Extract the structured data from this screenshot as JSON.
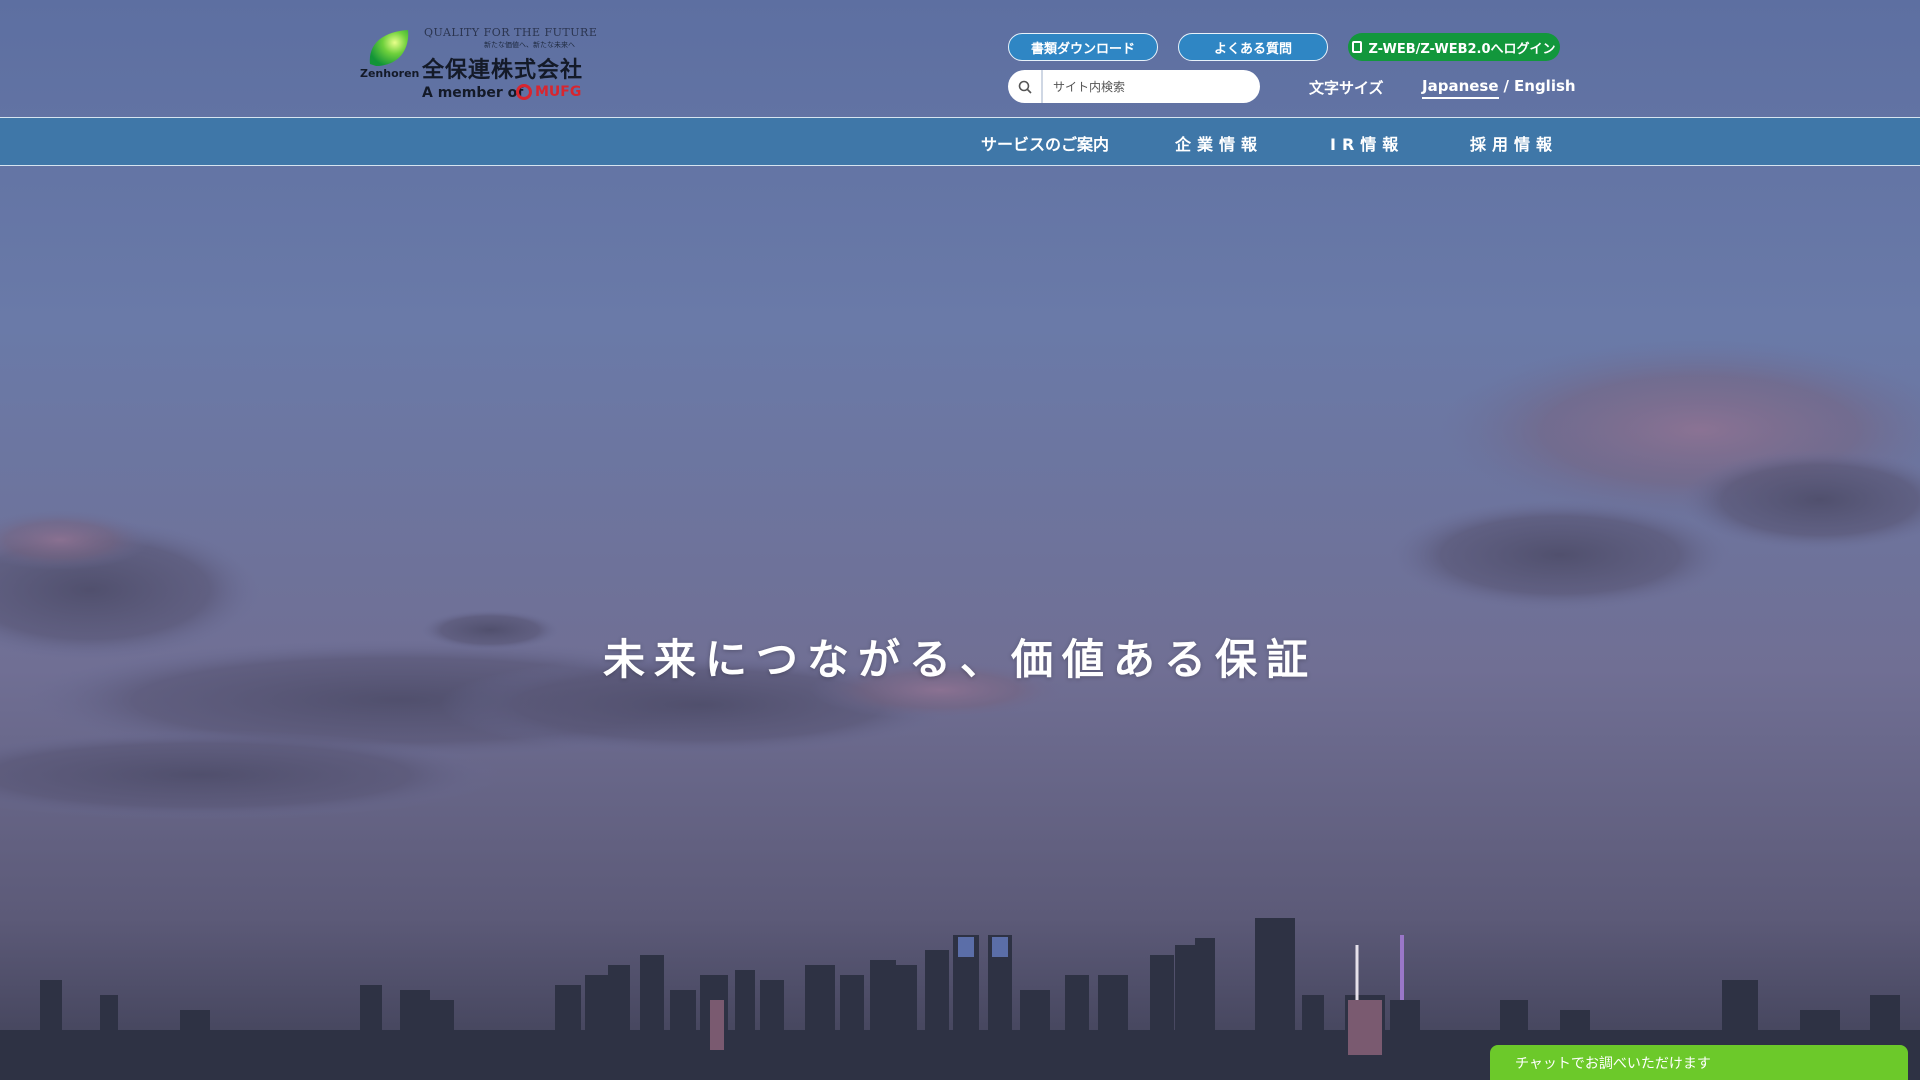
{
  "brand": {
    "tagline": "QUALITY FOR THE FUTURE",
    "subtagline": "新たな価値へ、新たな未来へ",
    "company_name": "全保連株式会社",
    "romaji": "Zenhoren",
    "member_prefix": "A member of",
    "group_name": "MUFG",
    "accent_color": "#2f86c4",
    "login_color": "#12973c"
  },
  "utility": {
    "download_label": "書類ダウンロード",
    "faq_label": "よくある質問",
    "login_label": "Z-WEB/Z-WEB2.0へログイン",
    "search_placeholder": "サイト内検索",
    "font_size_label": "文字サイズ",
    "lang_japanese": "Japanese",
    "lang_separator": "/",
    "lang_english": "English"
  },
  "nav": {
    "items": [
      {
        "label": "サービスのご案内"
      },
      {
        "label": "企業情報"
      },
      {
        "label": "IR情報"
      },
      {
        "label": "採用情報"
      }
    ]
  },
  "hero": {
    "headline": "未来につながる、価値ある保証"
  },
  "chat": {
    "label": "チャットでお調べいただけます",
    "color": "#6cc92a"
  }
}
